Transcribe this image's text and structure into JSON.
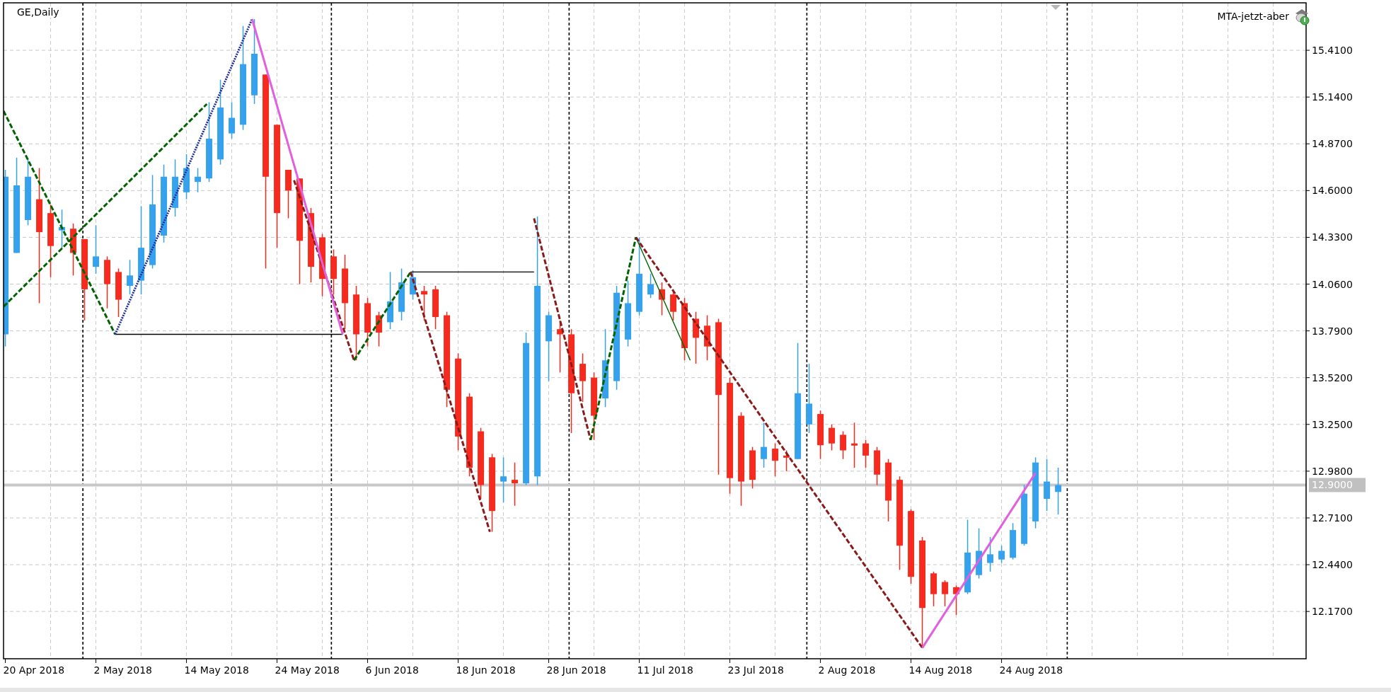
{
  "chart": {
    "symbol_label": "GE,Daily",
    "expert_name": "MTA-jetzt-aber",
    "price_labels": [
      "15.4100",
      "15.1400",
      "14.8700",
      "14.6000",
      "14.3300",
      "14.0600",
      "13.7900",
      "13.5200",
      "13.2500",
      "12.9800",
      "12.7100",
      "12.4400",
      "12.1700"
    ],
    "current_price": "12.9000",
    "date_labels": [
      "20 Apr 2018",
      "2 May 2018",
      "14 May 2018",
      "24 May 2018",
      "6 Jun 2018",
      "18 Jun 2018",
      "28 Jun 2018",
      "11 Jul 2018",
      "23 Jul 2018",
      "2 Aug 2018",
      "14 Aug 2018",
      "24 Aug 2018"
    ]
  }
}
